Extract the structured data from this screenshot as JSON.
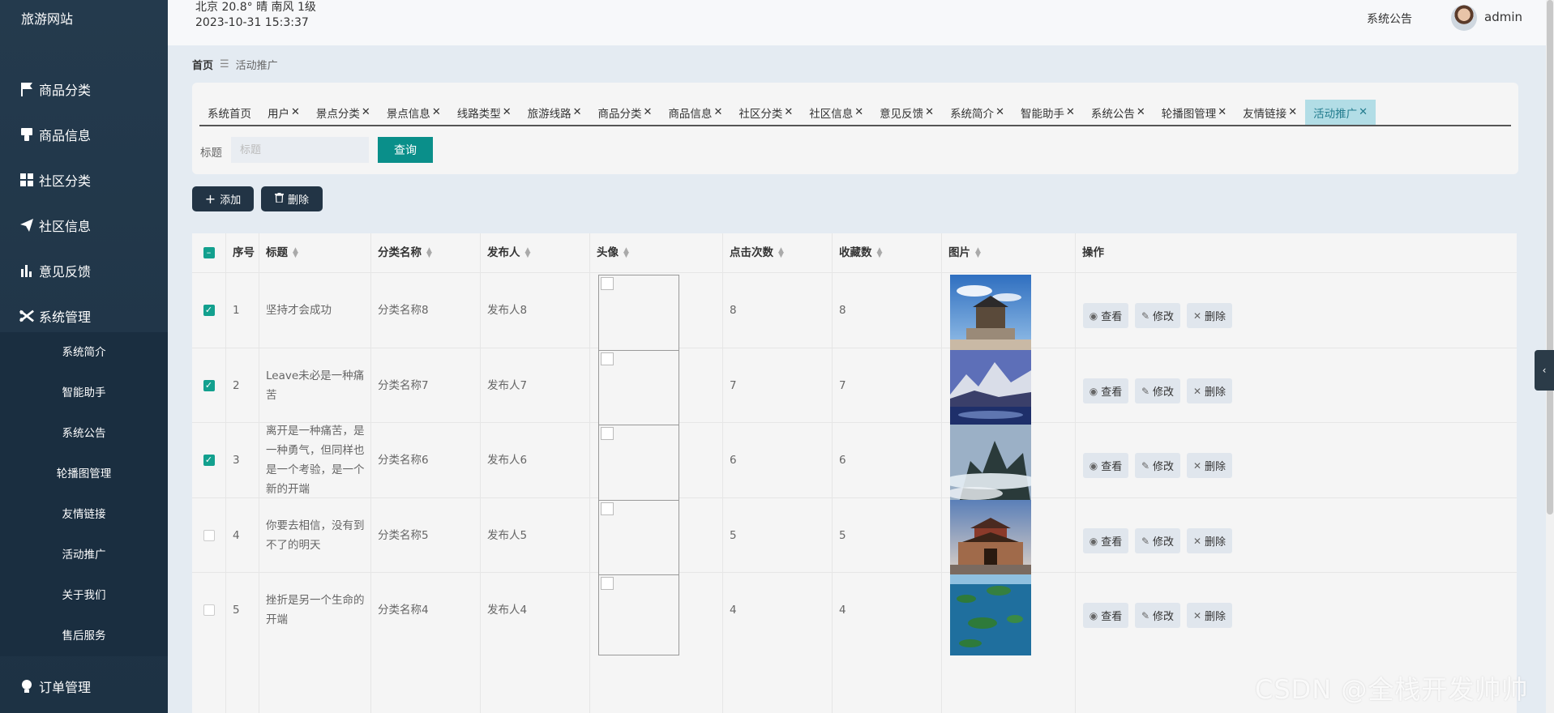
{
  "brand": "旅游网站",
  "sidebar": {
    "items": [
      {
        "label": "商品分类",
        "icon": "flag-icon"
      },
      {
        "label": "商品信息",
        "icon": "thumb-icon"
      },
      {
        "label": "社区分类",
        "icon": "grid-icon"
      },
      {
        "label": "社区信息",
        "icon": "send-icon"
      },
      {
        "label": "意见反馈",
        "icon": "bar-chart-icon"
      },
      {
        "label": "系统管理",
        "icon": "scissors-icon"
      }
    ],
    "submenu": [
      "系统简介",
      "智能助手",
      "系统公告",
      "轮播图管理",
      "友情链接",
      "活动推广",
      "关于我们",
      "售后服务"
    ],
    "order_item": {
      "label": "订单管理",
      "icon": "bulb-icon"
    }
  },
  "topbar": {
    "weather": "北京  20.8°  晴  南风  1级",
    "datetime": "2023-10-31 15:3:37",
    "notice": "系统公告",
    "username": "admin"
  },
  "breadcrumb": {
    "home": "首页",
    "current": "活动推广"
  },
  "tabs": [
    {
      "label": "系统首页",
      "closable": false
    },
    {
      "label": "用户",
      "closable": true
    },
    {
      "label": "景点分类",
      "closable": true
    },
    {
      "label": "景点信息",
      "closable": true
    },
    {
      "label": "线路类型",
      "closable": true
    },
    {
      "label": "旅游线路",
      "closable": true
    },
    {
      "label": "商品分类",
      "closable": true
    },
    {
      "label": "商品信息",
      "closable": true
    },
    {
      "label": "社区分类",
      "closable": true
    },
    {
      "label": "社区信息",
      "closable": true
    },
    {
      "label": "意见反馈",
      "closable": true
    },
    {
      "label": "系统简介",
      "closable": true
    },
    {
      "label": "智能助手",
      "closable": true
    },
    {
      "label": "系统公告",
      "closable": true
    },
    {
      "label": "轮播图管理",
      "closable": true
    },
    {
      "label": "友情链接",
      "closable": true
    },
    {
      "label": "活动推广",
      "closable": true,
      "active": true
    }
  ],
  "search": {
    "label": "标题",
    "placeholder": "标题",
    "button": "查询"
  },
  "actions": {
    "add": "添加",
    "delete": "删除"
  },
  "table": {
    "headers": [
      "序号",
      "标题",
      "分类名称",
      "发布人",
      "头像",
      "点击次数",
      "收藏数",
      "图片",
      "操作"
    ],
    "rows": [
      {
        "checked": true,
        "no": "1",
        "title": "坚持才会成功",
        "category": "分类名称8",
        "publisher": "发布人8",
        "clicks": "8",
        "favorites": "8",
        "photo": "tower"
      },
      {
        "checked": true,
        "no": "2",
        "title": "Leave未必是一种痛苦",
        "category": "分类名称7",
        "publisher": "发布人7",
        "clicks": "7",
        "favorites": "7",
        "photo": "mountain-lake"
      },
      {
        "checked": true,
        "no": "3",
        "title": "离开是一种痛苦，是一种勇气，但同样也是一个考验，是一个新的开端",
        "category": "分类名称6",
        "publisher": "发布人6",
        "clicks": "6",
        "favorites": "6",
        "photo": "misty-peak"
      },
      {
        "checked": false,
        "no": "4",
        "title": "你要去相信，没有到不了的明天",
        "category": "分类名称5",
        "publisher": "发布人5",
        "clicks": "5",
        "favorites": "5",
        "photo": "city-gate"
      },
      {
        "checked": false,
        "no": "5",
        "title": "挫折是另一个生命的开端",
        "category": "分类名称4",
        "publisher": "发布人4",
        "clicks": "4",
        "favorites": "4",
        "photo": "islands"
      }
    ],
    "ops": {
      "view": "查看",
      "edit": "修改",
      "delete": "删除"
    }
  },
  "watermark": "CSDN @全栈开发帅帅"
}
